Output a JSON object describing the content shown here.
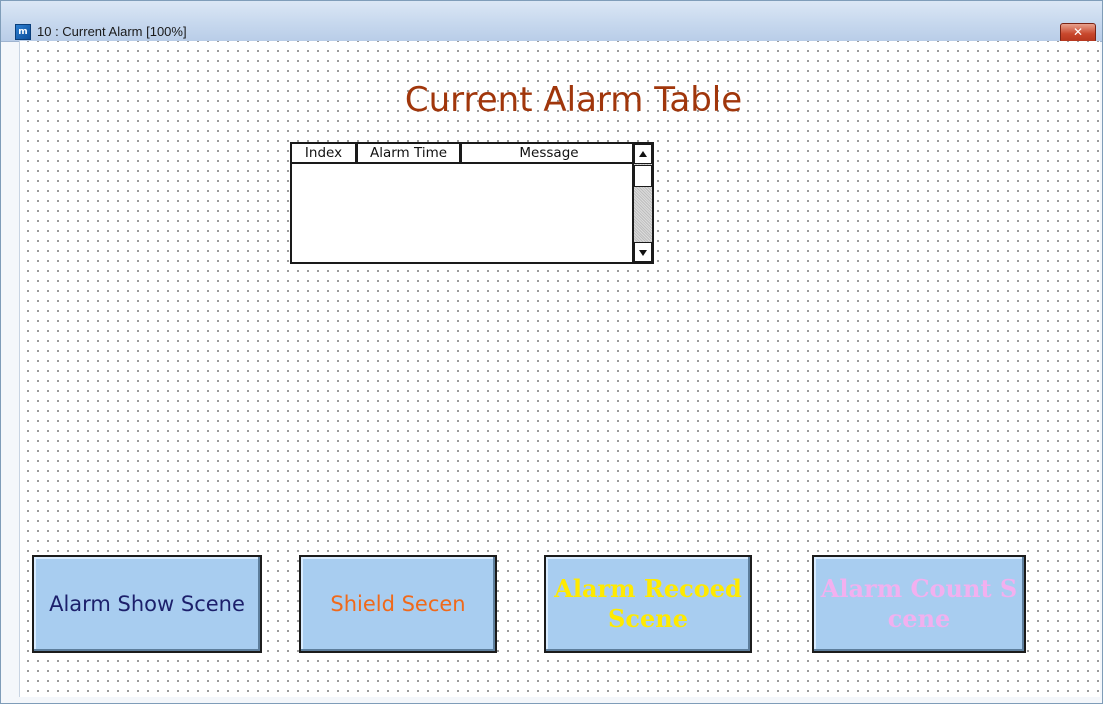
{
  "window": {
    "title": "10 : Current Alarm [100%]",
    "app_icon_glyph": "m",
    "close_glyph": "✕"
  },
  "heading": "Current Alarm Table",
  "alarm_table": {
    "columns": [
      "Index",
      "Alarm Time",
      "Message"
    ],
    "rows": []
  },
  "buttons": {
    "alarm_show": "Alarm Show Scene",
    "shield": "Shield Secen",
    "alarm_record": "Alarm Recoed Scene",
    "alarm_count": "Alarm Count Scene"
  },
  "colors": {
    "heading": "#a0360b",
    "button_bg": "#a8cdf0",
    "alarm_show_text": "#1c1f6b",
    "shield_text": "#f0691a",
    "alarm_record_text": "#ffea00",
    "alarm_count_text": "#f2b0ef"
  }
}
